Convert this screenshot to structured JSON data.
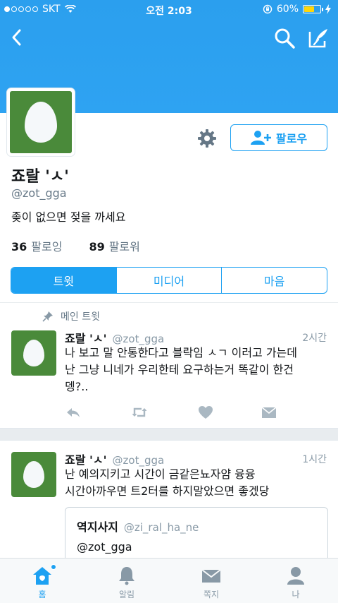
{
  "status_bar": {
    "carrier": "SKT",
    "time": "오전 2:03",
    "battery": "60%"
  },
  "profile": {
    "name": "죠랄 'ㅅ'",
    "handle": "@zot_gga",
    "bio": "좆이 없으면 젖을 까세요",
    "following_count": "36",
    "following_label": "팔로잉",
    "followers_count": "89",
    "followers_label": "팔로워",
    "follow_button": "팔로우"
  },
  "tabs": [
    {
      "label": "트윗",
      "active": true
    },
    {
      "label": "미디어",
      "active": false
    },
    {
      "label": "마음",
      "active": false
    }
  ],
  "pinned_label": "메인 트윗",
  "tweets": [
    {
      "name": "죠랄 'ㅅ'",
      "handle": "@zot_gga",
      "time": "2시간",
      "lines": [
        "나 보고 말 안통한다고 블락임 ㅅㄱ 이러고 가는데",
        "난 그냥 니네가 우리한테 요구하는거 똑같이 한건",
        "뎅?.."
      ]
    },
    {
      "name": "죠랄 'ㅅ'",
      "handle": "@zot_gga",
      "time": "1시간",
      "lines": [
        "난 예의지키고 시간이 금같은뇨자얌 융융",
        "시간아까우면 트2터를 하지말았으면 좋겠당"
      ],
      "quote": {
        "name": "역지사지",
        "handle": "@zi_ral_ha_ne",
        "text": "@zot_gga"
      }
    }
  ],
  "bottom_nav": [
    {
      "label": "홈",
      "icon": "home-icon",
      "active": true
    },
    {
      "label": "알림",
      "icon": "bell-icon",
      "active": false
    },
    {
      "label": "쪽지",
      "icon": "envelope-icon",
      "active": false
    },
    {
      "label": "나",
      "icon": "person-icon",
      "active": false
    }
  ],
  "colors": {
    "accent": "#1da1f2",
    "header": "#2ea3f2",
    "avatar_bg": "#4a8a3a"
  }
}
